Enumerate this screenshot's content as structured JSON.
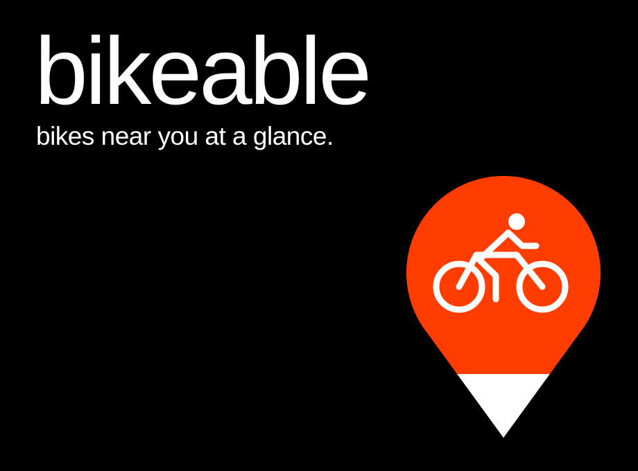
{
  "brand": {
    "name": "bikeable",
    "tagline": "bikes near you at a glance."
  },
  "logo": {
    "icon": "map-pin-bicycle-icon",
    "pin_color": "#ff3d00",
    "tip_color": "#ffffff",
    "glyph_color": "#ffffff"
  },
  "colors": {
    "background": "#000000",
    "text": "#ffffff"
  }
}
